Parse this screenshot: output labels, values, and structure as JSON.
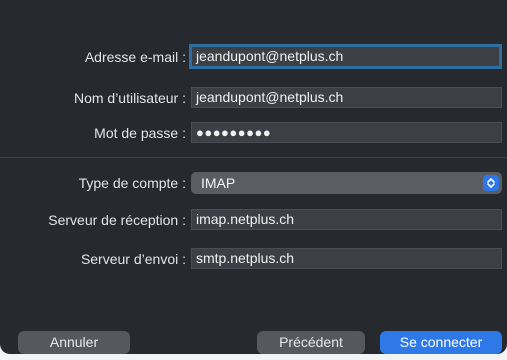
{
  "form": {
    "email": {
      "label": "Adresse e-mail :",
      "value": "jeandupont@netplus.ch"
    },
    "username": {
      "label": "Nom d’utilisateur :",
      "value": "jeandupont@netplus.ch"
    },
    "password": {
      "label": "Mot de passe :",
      "value": "●●●●●●●●●"
    },
    "account_type": {
      "label": "Type de compte :",
      "value": "IMAP"
    },
    "incoming": {
      "label": "Serveur de réception :",
      "value": "imap.netplus.ch"
    },
    "outgoing": {
      "label": "Serveur d’envoi :",
      "value": "smtp.netplus.ch"
    }
  },
  "buttons": {
    "cancel": "Annuler",
    "previous": "Précédent",
    "connect": "Se connecter"
  },
  "colors": {
    "accent": "#2f78e8",
    "focus_ring": "#2f6fa0",
    "panel": "#26292e"
  },
  "icons": {
    "select_stepper": "chevron-up-down-icon"
  }
}
